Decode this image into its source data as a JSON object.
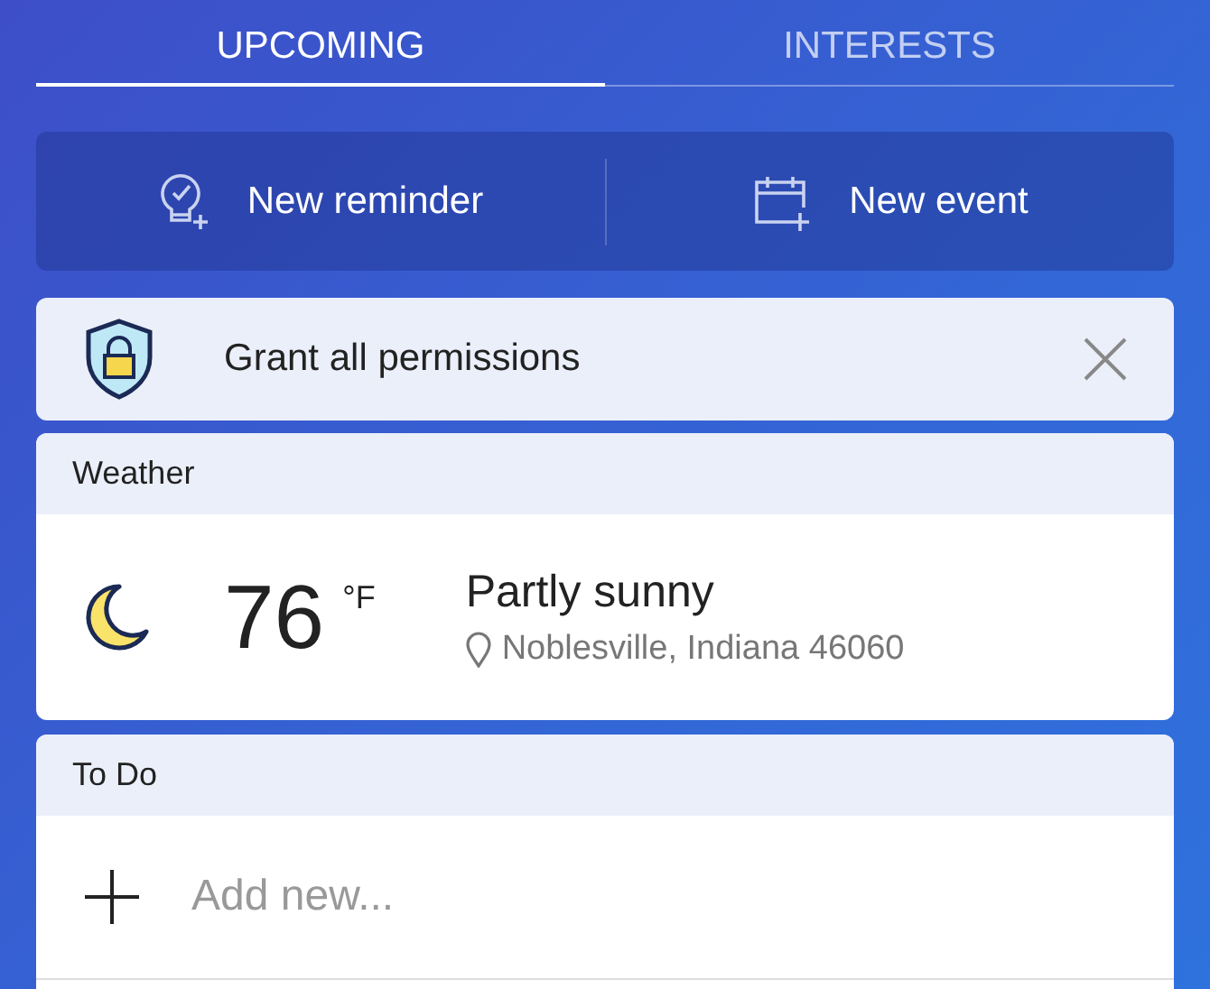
{
  "tabs": [
    {
      "label": "UPCOMING",
      "selected": true
    },
    {
      "label": "INTERESTS",
      "selected": false
    }
  ],
  "actions": [
    {
      "kind": "reminder",
      "label": "New reminder"
    },
    {
      "kind": "event",
      "label": "New event"
    }
  ],
  "permission_banner": {
    "label": "Grant all permissions"
  },
  "weather": {
    "title": "Weather",
    "temperature": "76",
    "unit": "°F",
    "condition": "Partly sunny",
    "location": "Noblesville, Indiana 46060"
  },
  "todo": {
    "title": "To Do",
    "placeholder": "Add new..."
  }
}
